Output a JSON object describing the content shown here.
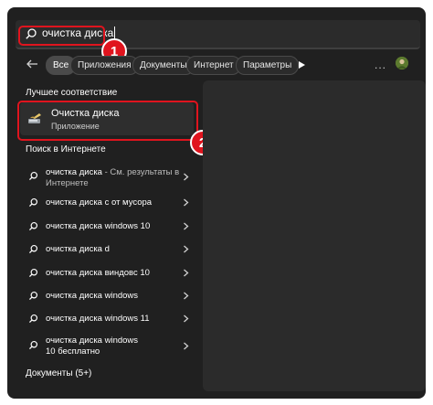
{
  "search": {
    "value": "очистка диска"
  },
  "filters": {
    "chips": [
      "Все",
      "Приложения",
      "Документы",
      "Интернет",
      "Параметры"
    ],
    "more": "..."
  },
  "sections": {
    "best_match": "Лучшее соответствие",
    "web": "Поиск в Интернете",
    "documents": "Документы (5+)"
  },
  "best_match": {
    "name": "Очистка диска",
    "type": "Приложение"
  },
  "web_results": [
    {
      "query": "очистка диска",
      "suffix": " - См. результаты в Интернете"
    },
    {
      "query": "очистка диска с от мусора",
      "suffix": ""
    },
    {
      "query": "очистка диска windows 10",
      "suffix": ""
    },
    {
      "query": "очистка диска d",
      "suffix": ""
    },
    {
      "query": "очистка диска виндовс 10",
      "suffix": ""
    },
    {
      "query": "очистка диска windows",
      "suffix": ""
    },
    {
      "query": "очистка диска windows 11",
      "suffix": ""
    },
    {
      "query": "очистка диска windows 10 бесплатно",
      "suffix": ""
    }
  ],
  "callouts": [
    "1",
    "2"
  ],
  "colors": {
    "highlight": "#e0141e",
    "background": "#202020"
  }
}
